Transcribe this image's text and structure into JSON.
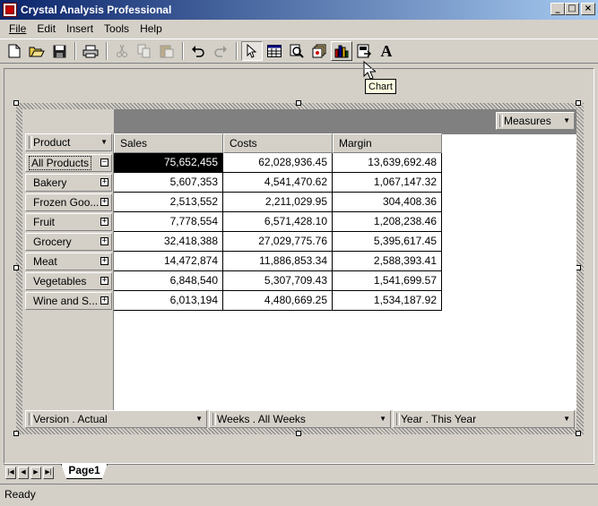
{
  "window": {
    "title": "Crystal Analysis Professional",
    "buttons": [
      "_",
      "□",
      "×"
    ]
  },
  "menu": [
    {
      "label": "File"
    },
    {
      "label": "Edit"
    },
    {
      "label": "Insert"
    },
    {
      "label": "Tools"
    },
    {
      "label": "Help"
    }
  ],
  "toolbar": {
    "tooltip": "Chart",
    "buttons": [
      "new-icon",
      "open-icon",
      "save-icon",
      "print-icon",
      "cut-icon",
      "copy-icon",
      "paste-icon",
      "undo-icon",
      "redo-icon",
      "select-pointer-icon",
      "grid-icon",
      "analyze-icon",
      "slice-icon",
      "chart-icon",
      "export-icon",
      "text-icon"
    ]
  },
  "grid": {
    "measures_label": "Measures",
    "row_dimension": "Product",
    "columns": [
      "Sales",
      "Costs",
      "Margin"
    ],
    "rows": [
      {
        "label": "All Products",
        "values": [
          "75,652,455",
          "62,028,936.45",
          "13,639,692.48"
        ],
        "expander": "−"
      },
      {
        "label": "Bakery",
        "values": [
          "5,607,353",
          "4,541,470.62",
          "1,067,147.32"
        ],
        "expander": "+"
      },
      {
        "label": "Frozen Goo...",
        "values": [
          "2,513,552",
          "2,211,029.95",
          "304,408.36"
        ],
        "expander": "+"
      },
      {
        "label": "Fruit",
        "values": [
          "7,778,554",
          "6,571,428.10",
          "1,208,238.46"
        ],
        "expander": "+"
      },
      {
        "label": "Grocery",
        "values": [
          "32,418,388",
          "27,029,775.76",
          "5,395,617.45"
        ],
        "expander": "+"
      },
      {
        "label": "Meat",
        "values": [
          "14,472,874",
          "11,886,853.34",
          "2,588,393.41"
        ],
        "expander": "+"
      },
      {
        "label": "Vegetables",
        "values": [
          "6,848,540",
          "5,307,709.43",
          "1,541,699.57"
        ],
        "expander": "+"
      },
      {
        "label": "Wine and S...",
        "values": [
          "6,013,194",
          "4,480,669.25",
          "1,534,187.92"
        ],
        "expander": "+"
      }
    ],
    "slicers": [
      {
        "label": "Version . Actual"
      },
      {
        "label": "Weeks . All Weeks"
      },
      {
        "label": "Year . This Year"
      }
    ]
  },
  "sheet_tab": "Page1",
  "status": "Ready"
}
